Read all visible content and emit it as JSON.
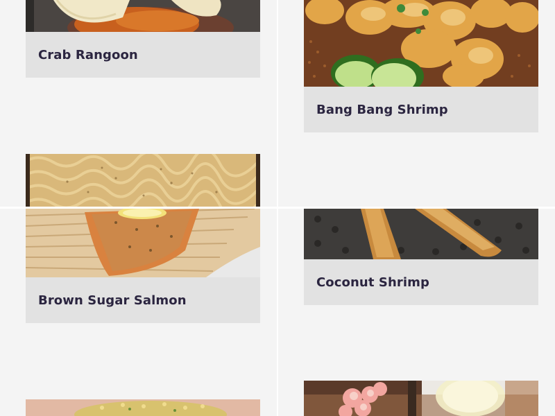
{
  "recipes": [
    {
      "name": "Crab Rangoon"
    },
    {
      "name": "Bang Bang Shrimp"
    },
    {
      "name": "Brown Sugar Salmon"
    },
    {
      "name": "Coconut Shrimp"
    }
  ],
  "colors": {
    "label_bg": "#e2e2e2",
    "label_text": "#2b2540",
    "page_bg": "#f4f4f4"
  },
  "icons": [
    "crab-rangoon-photo",
    "bang-bang-shrimp-photo",
    "ramen-photo",
    "brown-sugar-salmon-photo",
    "coconut-shrimp-photo",
    "fried-rice-photo",
    "flower-drink-photo"
  ]
}
